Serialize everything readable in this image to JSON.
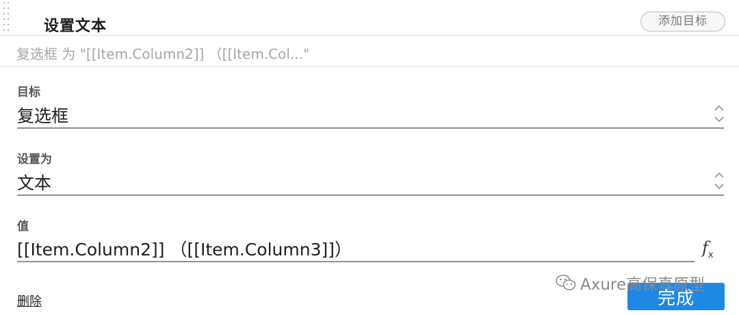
{
  "header": {
    "title": "设置文本",
    "add_target_label": "添加目标"
  },
  "summary": "复选框 为 \"[[Item.Column2]] （[[Item.Col...\"",
  "fields": {
    "target": {
      "label": "目标",
      "value": "复选框"
    },
    "set_as": {
      "label": "设置为",
      "value": "文本"
    },
    "value": {
      "label": "值",
      "value": "[[Item.Column2]] （[[Item.Column3]]）",
      "fx_icon": "function-icon"
    }
  },
  "footer": {
    "delete_label": "删除",
    "done_label": "完成"
  },
  "watermark": {
    "icon": "wechat-icon",
    "text": "Axure高保真原型"
  },
  "colors": {
    "done_button": "#1e88e5",
    "summary_text": "#a6a6a6",
    "divider": "#e1e1e1"
  }
}
